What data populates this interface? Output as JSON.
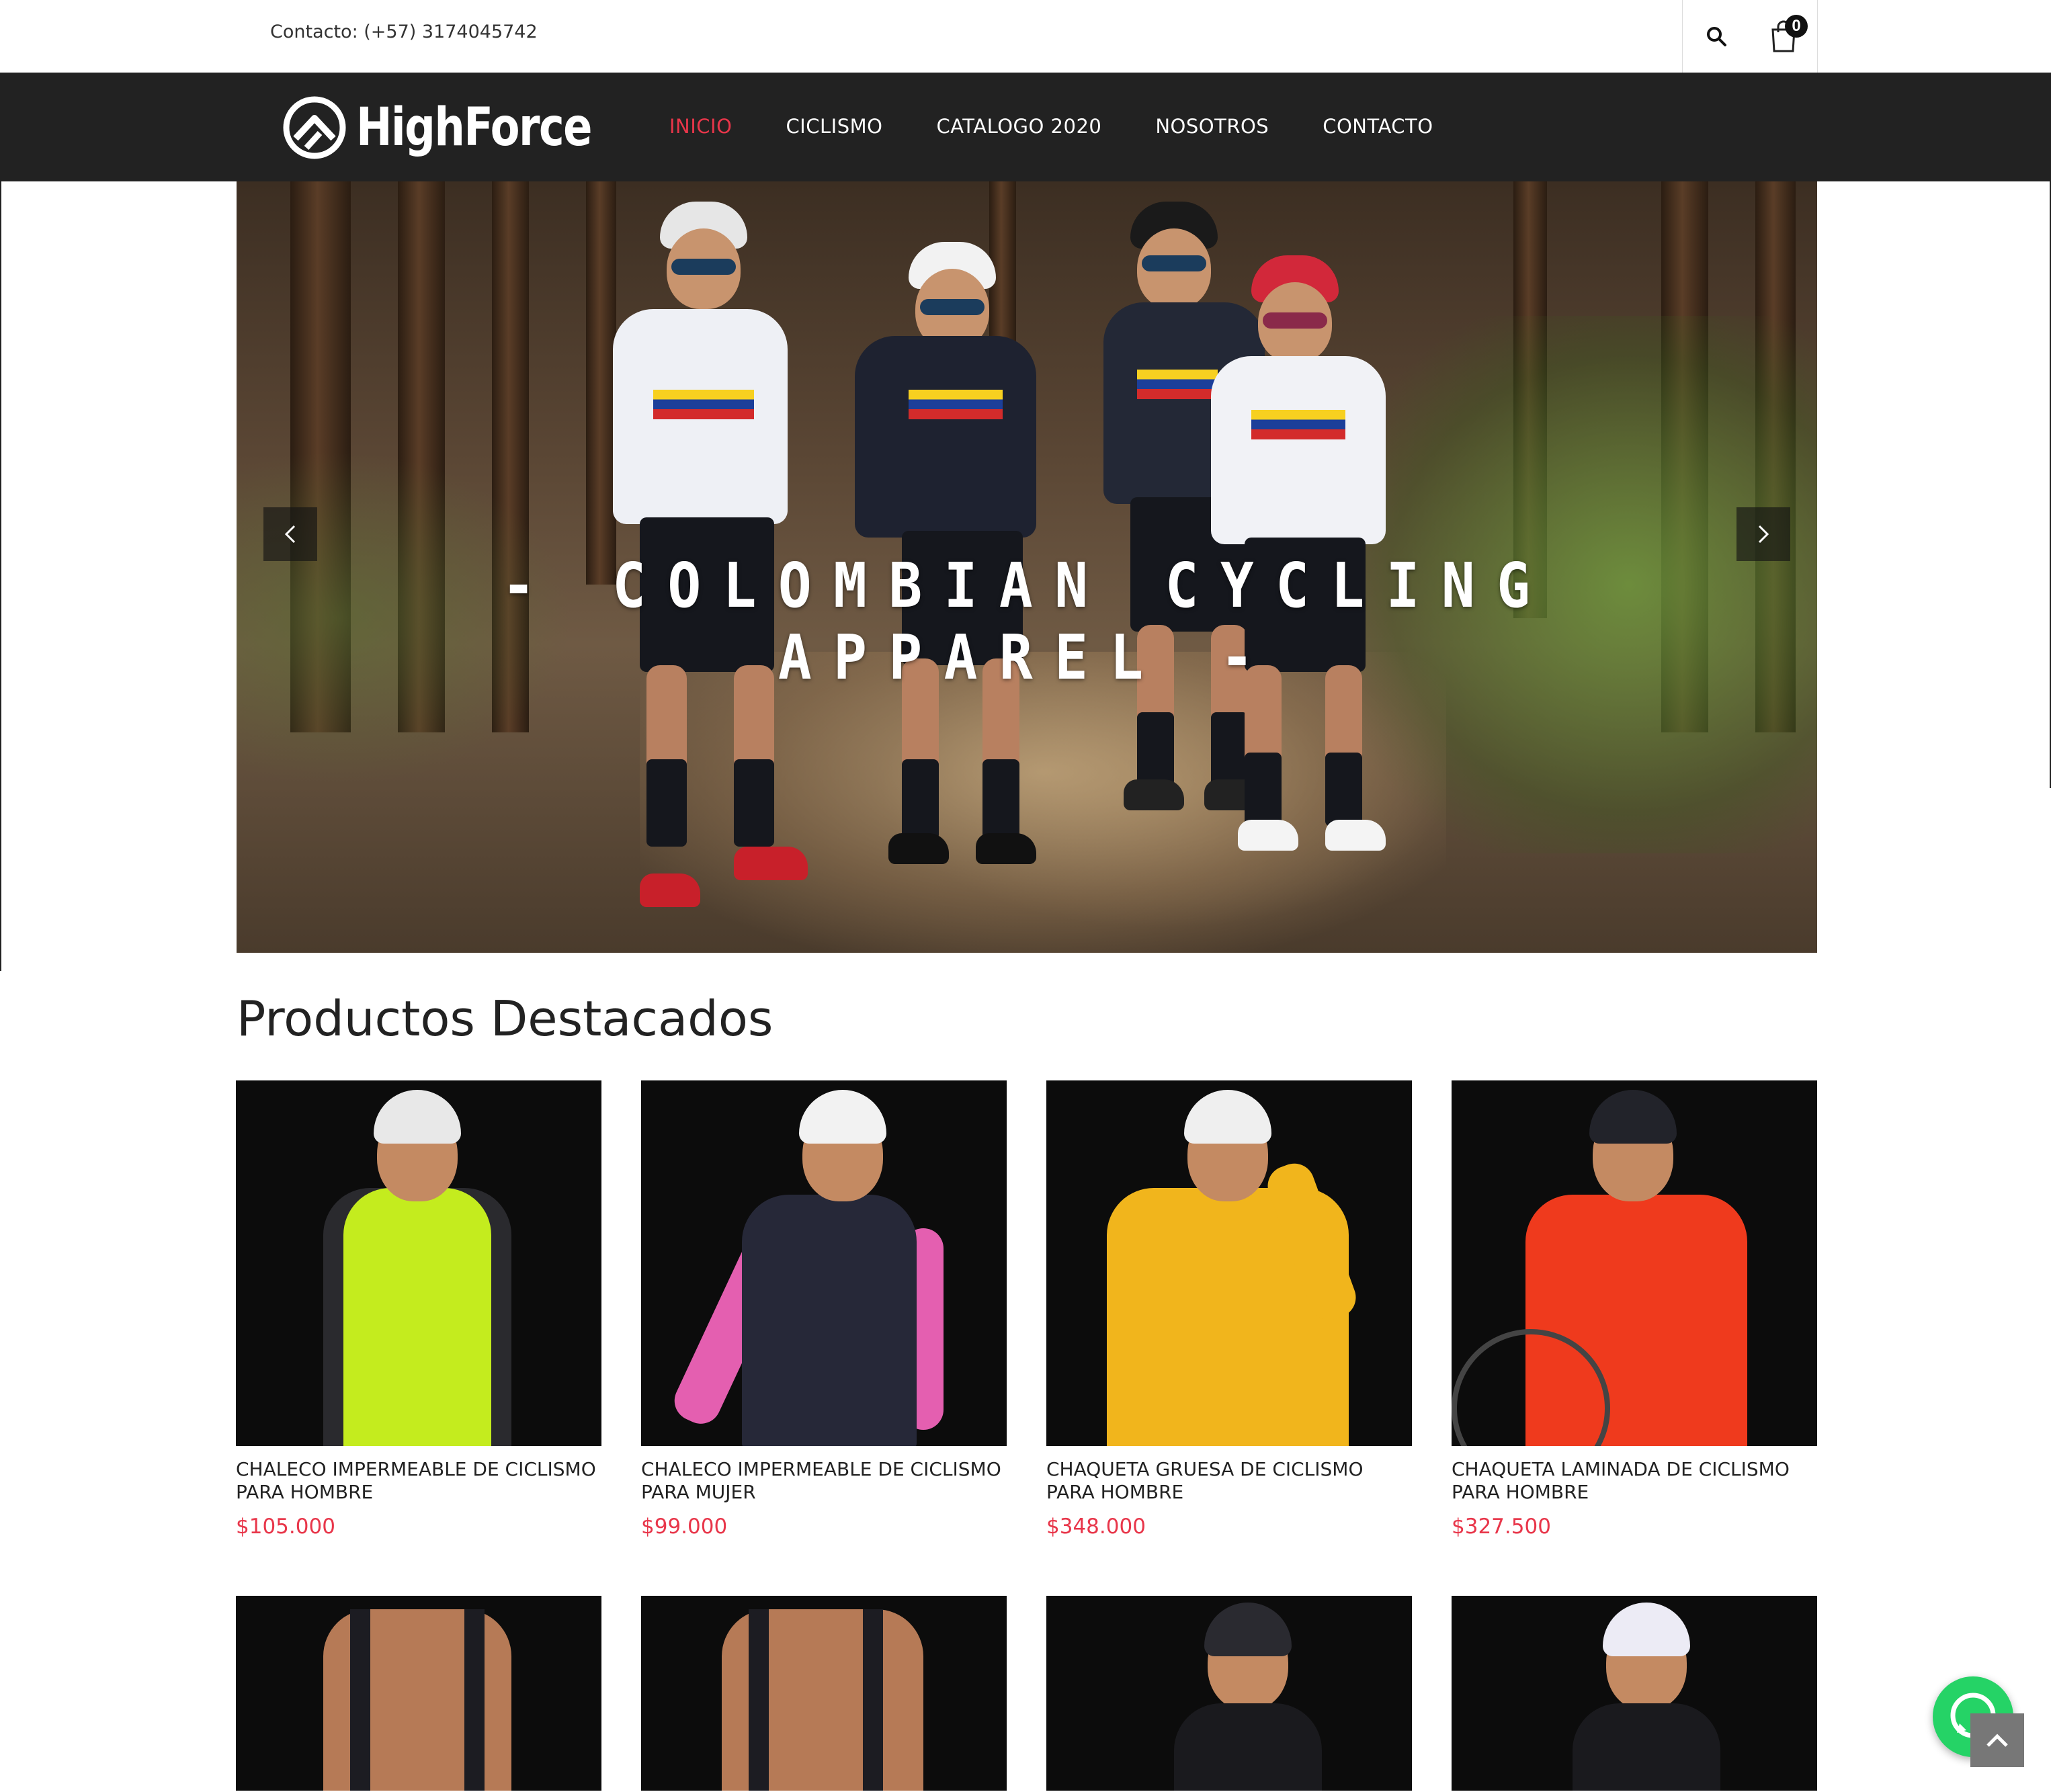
{
  "topbar": {
    "contact": "Contacto: (+57) 3174045742",
    "cart_count": "0"
  },
  "brand": {
    "name": "HighForce"
  },
  "nav": [
    {
      "label": "INICIO",
      "active": true
    },
    {
      "label": "CICLISMO"
    },
    {
      "label": "CATALOGO 2020"
    },
    {
      "label": "NOSOTROS"
    },
    {
      "label": "CONTACTO"
    }
  ],
  "hero": {
    "title": "- COLOMBIAN CYCLING APPAREL -"
  },
  "featured": {
    "title": "Productos Destacados",
    "products": [
      {
        "name": "CHALECO IMPERMEABLE DE CICLISMO PARA HOMBRE",
        "price": "$105.000"
      },
      {
        "name": "CHALECO IMPERMEABLE DE CICLISMO PARA MUJER",
        "price": "$99.000"
      },
      {
        "name": "CHAQUETA GRUESA DE CICLISMO PARA HOMBRE",
        "price": "$348.000"
      },
      {
        "name": "CHAQUETA LAMINADA DE CICLISMO PARA HOMBRE",
        "price": "$327.500"
      }
    ]
  },
  "colors": {
    "accent": "#e8364a",
    "nav_bg": "#222222",
    "whatsapp": "#25d366"
  },
  "icons": [
    "search-icon",
    "cart-icon",
    "chevron-left-icon",
    "chevron-right-icon",
    "whatsapp-icon",
    "arrow-up-icon"
  ]
}
